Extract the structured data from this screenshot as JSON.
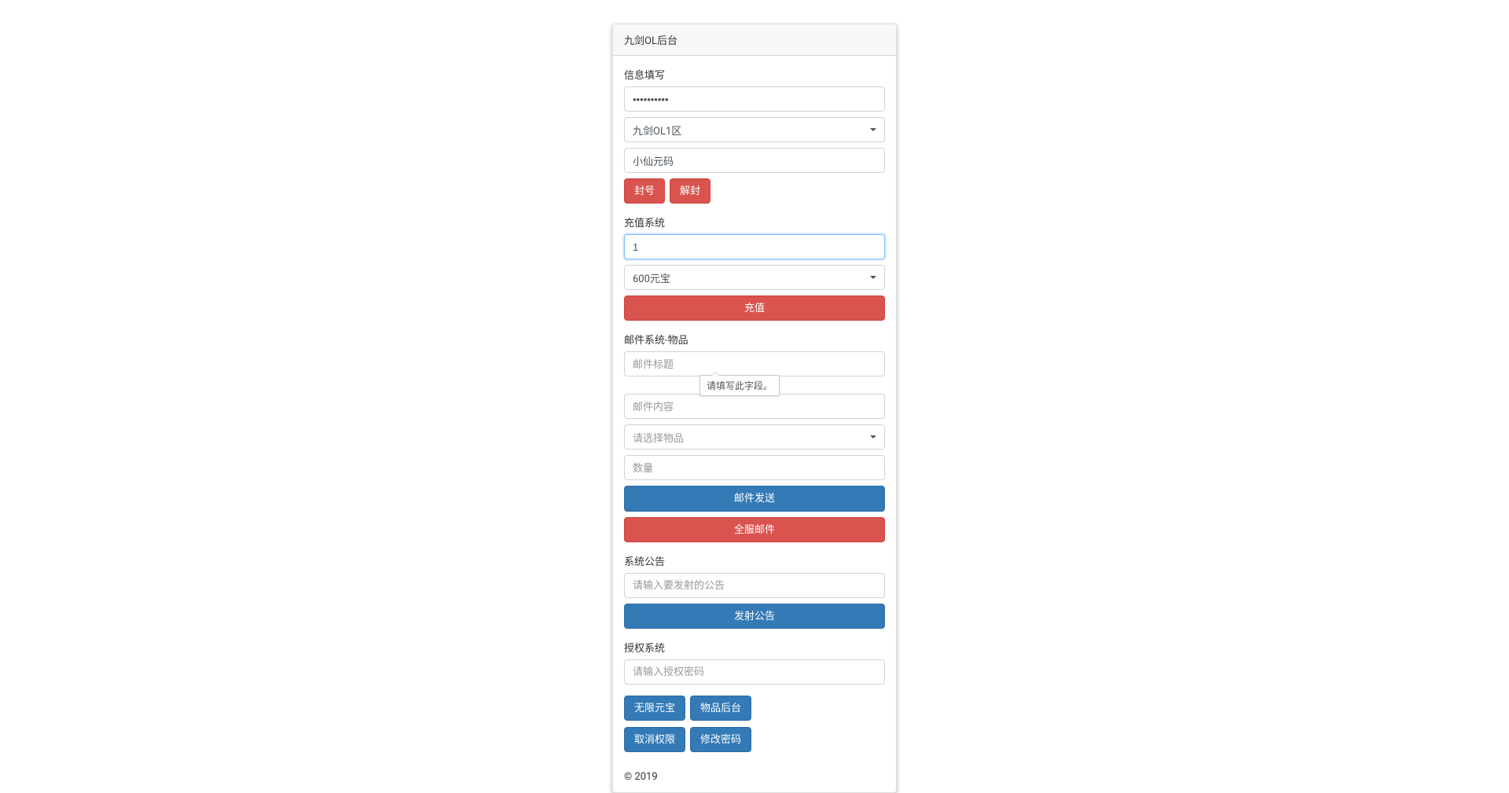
{
  "header": {
    "title": "九剑OL后台"
  },
  "info": {
    "label": "信息填写",
    "password_value": "••••••••••",
    "server_selected": "九剑OL1区",
    "character_value": "小仙元码",
    "ban_label": "封号",
    "unban_label": "解封"
  },
  "recharge": {
    "label": "充值系统",
    "amount_value": "1",
    "package_selected": "600元宝",
    "recharge_label": "充值"
  },
  "mail": {
    "label": "邮件系统-物品",
    "title_placeholder": "邮件标题",
    "content_placeholder": "邮件内容",
    "item_selected": "请选择物品",
    "qty_placeholder": "数量",
    "send_label": "邮件发送",
    "broadcast_label": "全服邮件",
    "tooltip_text": "请填写此字段。"
  },
  "announce": {
    "label": "系统公告",
    "placeholder": "请输入要发射的公告",
    "send_label": "发射公告"
  },
  "auth": {
    "label": "授权系统",
    "placeholder": "请输入授权密码",
    "unlimited_label": "无限元宝",
    "item_bg_label": "物品后台",
    "revoke_label": "取消权限",
    "change_pw_label": "修改密码"
  },
  "footer": {
    "copyright": "© 2019"
  }
}
